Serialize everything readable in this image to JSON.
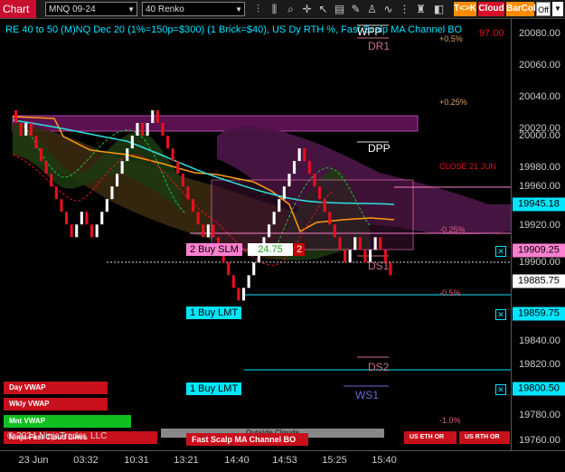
{
  "toolbar": {
    "tab": "Chart",
    "instrument": "MNQ 09-24",
    "bar_type": "40 Renko",
    "btn_tk": "T<>K",
    "btn_cloud": "Cloud",
    "btn_barcol": "BarCol",
    "btn_off": "Off"
  },
  "chart": {
    "title": "RE 40 to 50 (M)NQ Dec 20 (1%=150p=$300) (1 Brick=$40), US Dy RTH %, Fast Scalp MA Channel BO",
    "pct_plus_050": "+0.5%",
    "price_97": "97.00",
    "pct_plus_025": "+0.25%",
    "close_label": "CLOSE 21 JUN",
    "pct_minus_025": "-0.25%",
    "pct_minus_050": "-0.5%",
    "pct_minus_100": "-1.0%",
    "wpp": "WPP",
    "dr1": "DR1",
    "dpp": "DPP",
    "ds1": "DS1",
    "ds2": "DS2",
    "ws1": "WS1",
    "copyright": "© 2024 NinjaTrader, LLC",
    "ninja_overlay": "Ninja Fast Cloud Lines",
    "outside_clouds": "Outside Clouds",
    "fast_scalp_btn": "Fast Scalp MA Channel BO",
    "us_eth_or": "US ETH OR",
    "us_rth_or": "US RTH OR"
  },
  "buttons": {
    "day_vwap": "Day VWAP",
    "wkly_vwap": "Wkly VWAP",
    "mnt_vwap": "Mnt VWAP"
  },
  "orders": {
    "buy_slm": "2 Buy SLM",
    "buy_slm_price": "24.75",
    "buy_slm_qty": "2",
    "buy_lmt_1": "1 Buy LMT",
    "buy_lmt_2": "1 Buy LMT",
    "close_x": "✕"
  },
  "y_axis": {
    "ticks": [
      "20080.00",
      "20060.00",
      "20040.00",
      "20020.00",
      "20000.00",
      "19980.00",
      "19960.00",
      "19940.00",
      "19920.00",
      "19900.00",
      "19880.00",
      "19840.00",
      "19820.00",
      "19780.00",
      "19760.00"
    ],
    "tag_last": "19945.18",
    "tag_order1": "19909.25",
    "tag_price": "19885.75",
    "tag_lmt1": "19859.75",
    "tag_lmt2": "19800.50"
  },
  "x_axis": {
    "labels": [
      "23 Jun",
      "03:32",
      "10:31",
      "13:21",
      "14:40",
      "14:53",
      "15:25",
      "15:40"
    ]
  },
  "colors": {
    "bull": "#ffffff",
    "bear": "#e8101c",
    "cloud": "#6a1a55",
    "accent": "#00e5ff"
  },
  "chart_data": {
    "type": "renko",
    "brick_size": 10,
    "closes": [
      20010,
      20000,
      20010,
      20000,
      19990,
      19980,
      19970,
      19960,
      19950,
      19940,
      19930,
      19920,
      19930,
      19940,
      19930,
      19920,
      19930,
      19940,
      19950,
      19960,
      19970,
      19980,
      19990,
      20000,
      20010,
      20000,
      20010,
      20020,
      20010,
      20000,
      19990,
      19980,
      19970,
      19960,
      19950,
      19940,
      19930,
      19920,
      19930,
      19920,
      19910,
      19900,
      19890,
      19880,
      19870,
      19880,
      19890,
      19900,
      19910,
      19920,
      19930,
      19940,
      19950,
      19960,
      19970,
      19980,
      19990,
      19980,
      19970,
      19960,
      19950,
      19940,
      19930,
      19920,
      19910,
      19900,
      19910,
      19920,
      19910,
      19900,
      19910,
      19920,
      19910,
      19900,
      19890
    ],
    "ylim": [
      19752,
      20092
    ]
  }
}
